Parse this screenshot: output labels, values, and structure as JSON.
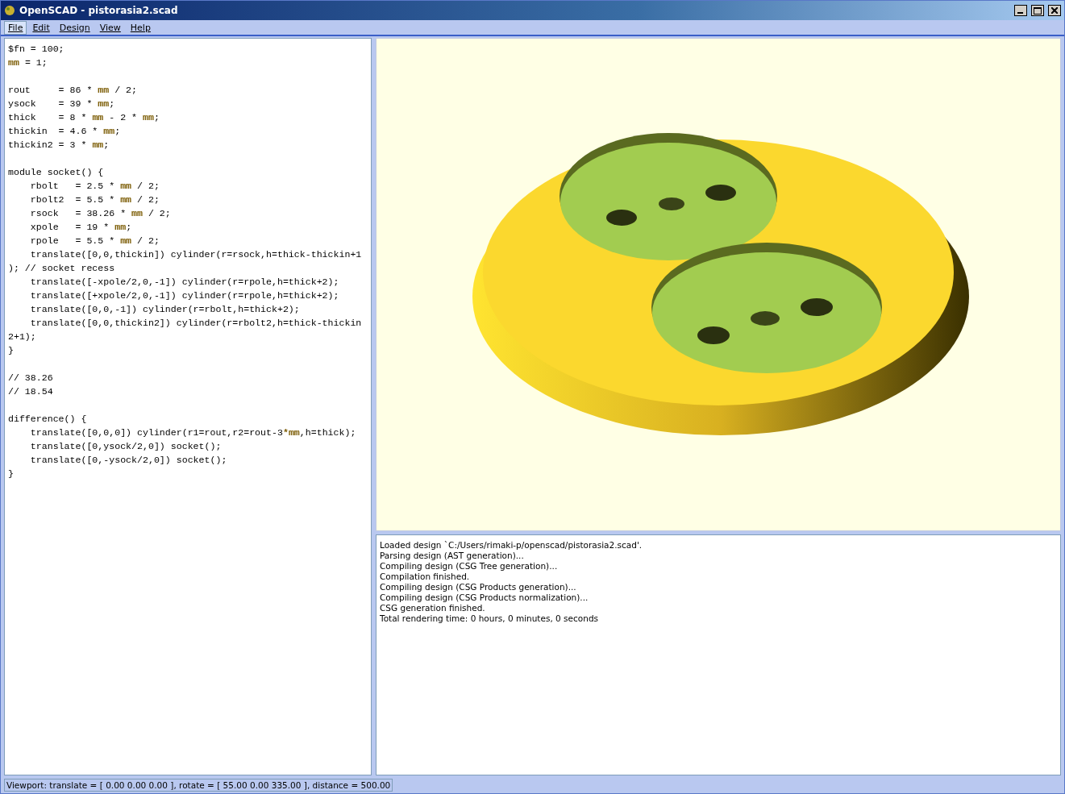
{
  "window": {
    "title": "OpenSCAD - pistorasia2.scad"
  },
  "menu": [
    {
      "label": "File",
      "selected": true
    },
    {
      "label": "Edit",
      "selected": false
    },
    {
      "label": "Design",
      "selected": false
    },
    {
      "label": "View",
      "selected": false
    },
    {
      "label": "Help",
      "selected": false
    }
  ],
  "editor": {
    "blocks": [
      [
        "$fn = 100;",
        "**mm** = 1;"
      ],
      [
        "rout     = 86 * **mm** / 2;",
        "ysock    = 39 * **mm**;",
        "thick    = 8 * **mm** - 2 * **mm**;",
        "thickin  = 4.6 * **mm**;",
        "thickin2 = 3 * **mm**;"
      ],
      [
        "module socket() {",
        "    rbolt   = 2.5 * **mm** / 2;",
        "    rbolt2  = 5.5 * **mm** / 2;",
        "    rsock   = 38.26 * **mm** / 2;",
        "    xpole   = 19 * **mm**;",
        "    rpole   = 5.5 * **mm** / 2;",
        "    translate([0,0,thickin]) cylinder(r=rsock,h=thick-thickin+1",
        "); // socket recess",
        "    translate([-xpole/2,0,-1]) cylinder(r=rpole,h=thick+2);",
        "    translate([+xpole/2,0,-1]) cylinder(r=rpole,h=thick+2);",
        "    translate([0,0,-1]) cylinder(r=rbolt,h=thick+2);",
        "    translate([0,0,thickin2]) cylinder(r=rbolt2,h=thick-thickin",
        "2+1);",
        "}"
      ],
      [
        "// 38.26",
        "// 18.54"
      ],
      [
        "difference() {",
        "    translate([0,0,0]) cylinder(r1=rout,r2=rout-3***mm**,h=thick);",
        "    translate([0,ysock/2,0]) socket();",
        "    translate([0,-ysock/2,0]) socket();",
        "}"
      ]
    ]
  },
  "console": [
    "Loaded design `C:/Users/rimaki-p/openscad/pistorasia2.scad'.",
    "Parsing design (AST generation)...",
    "Compiling design (CSG Tree generation)...",
    "Compilation finished.",
    "Compiling design (CSG Products generation)...",
    "Compiling design (CSG Products normalization)...",
    "CSG generation finished.",
    "Total rendering time: 0 hours, 0 minutes, 0 seconds"
  ],
  "status_bar": "Viewport: translate = [ 0.00 0.00 0.00 ], rotate = [ 55.00 0.00 335.00 ], distance = 500.00"
}
